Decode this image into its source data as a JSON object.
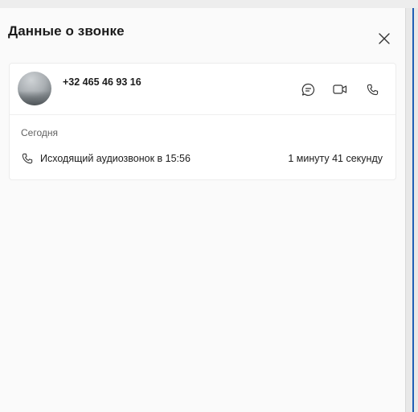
{
  "header": {
    "title": "Данные о звонке",
    "close_icon": "close-icon"
  },
  "contact": {
    "phone_number": "+32 465 46 93 16",
    "avatar": "contact-avatar",
    "actions": [
      {
        "name": "chat",
        "icon": "chat-icon"
      },
      {
        "name": "video-call",
        "icon": "video-icon"
      },
      {
        "name": "audio-call",
        "icon": "phone-icon"
      }
    ]
  },
  "history": {
    "section_label": "Сегодня",
    "calls": [
      {
        "icon": "phone-icon",
        "description": "Исходящий аудиозвонок в 15:56",
        "duration": "1 минуту 41 секунду"
      }
    ]
  },
  "colors": {
    "accent_edge": "#1f5fb5",
    "panel_bg": "#fafafa",
    "card_bg": "#ffffff",
    "secondary_text": "#616161"
  }
}
